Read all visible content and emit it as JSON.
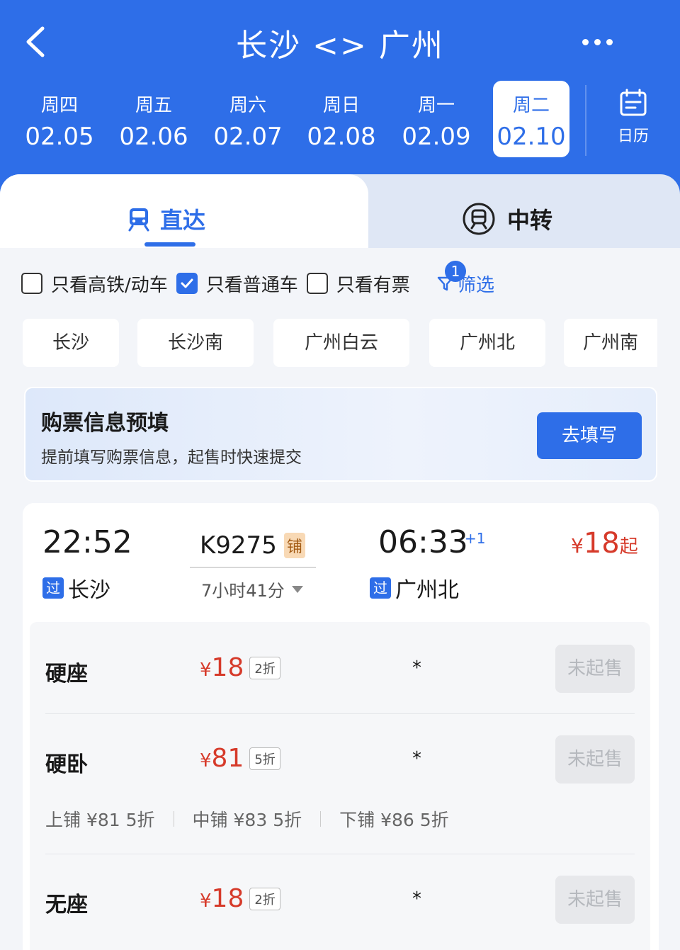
{
  "header": {
    "title": "长沙 <> 广州",
    "dates": [
      {
        "weekday": "周四",
        "date": "02.05"
      },
      {
        "weekday": "周五",
        "date": "02.06"
      },
      {
        "weekday": "周六",
        "date": "02.07"
      },
      {
        "weekday": "周日",
        "date": "02.08"
      },
      {
        "weekday": "周一",
        "date": "02.09"
      },
      {
        "weekday": "周二",
        "date": "02.10"
      }
    ],
    "calendar_label": "日历"
  },
  "tabs": {
    "direct": "直达",
    "transfer": "中转"
  },
  "filters": {
    "high_speed": "只看高铁/动车",
    "regular": "只看普通车",
    "available": "只看有票",
    "screen": "筛选",
    "screen_badge": "1"
  },
  "stations": [
    "长沙",
    "长沙南",
    "广州白云",
    "广州北",
    "广州南"
  ],
  "prefill": {
    "title": "购票信息预填",
    "subtitle": "提前填写购票信息，起售时快速提交",
    "button": "去填写"
  },
  "train": {
    "depart_time": "22:52",
    "depart_station": "长沙",
    "depart_tag": "过",
    "number": "K9275",
    "number_tag": "铺",
    "duration": "7小时41分",
    "arrive_time": "06:33",
    "arrive_plus": "+1",
    "arrive_station": "广州北",
    "arrive_tag": "过",
    "price_currency": "¥",
    "price_from": "18",
    "price_suffix": "起",
    "seats": [
      {
        "name": "硬座",
        "currency": "¥",
        "price": "18",
        "discount": "2折",
        "avail": "*",
        "status": "未起售"
      },
      {
        "name": "硬卧",
        "currency": "¥",
        "price": "81",
        "discount": "5折",
        "avail": "*",
        "status": "未起售"
      },
      {
        "name": "无座",
        "currency": "¥",
        "price": "18",
        "discount": "2折",
        "avail": "*",
        "status": "未起售"
      }
    ],
    "berths": [
      {
        "name": "上铺",
        "price": "¥81",
        "discount": "5折"
      },
      {
        "name": "中铺",
        "price": "¥83",
        "discount": "5折"
      },
      {
        "name": "下铺",
        "price": "¥86",
        "discount": "5折"
      }
    ]
  },
  "colors": {
    "primary": "#2e6ee8",
    "price": "#d63a2a"
  }
}
